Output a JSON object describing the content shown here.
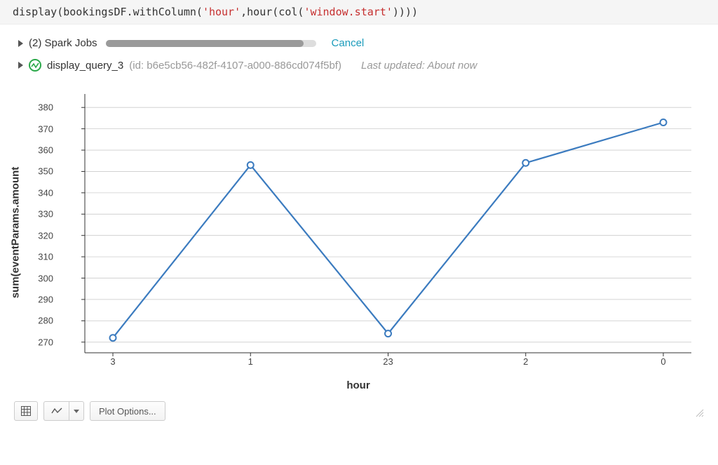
{
  "code": {
    "prefix": "display(bookingsDF.withColumn(",
    "str1": "'hour'",
    "mid": ",hour(col(",
    "str2": "'window.start'",
    "suffix": "))))"
  },
  "jobs": {
    "count_label": "(2) Spark Jobs",
    "cancel_label": "Cancel",
    "progress_pct": 94
  },
  "query": {
    "name": "display_query_3",
    "id_label": "(id: b6e5cb56-482f-4107-a000-886cd074f5bf)",
    "last_updated_label": "Last updated: About now"
  },
  "toolbar": {
    "plot_options_label": "Plot Options..."
  },
  "chart_data": {
    "type": "line",
    "xlabel": "hour",
    "ylabel": "sum(eventParams.amount",
    "categories": [
      "3",
      "1",
      "23",
      "2",
      "0"
    ],
    "values": [
      272,
      353,
      274,
      354,
      373
    ],
    "ylim": [
      265,
      385
    ],
    "y_ticks": [
      270,
      280,
      290,
      300,
      310,
      320,
      330,
      340,
      350,
      360,
      370,
      380
    ]
  }
}
